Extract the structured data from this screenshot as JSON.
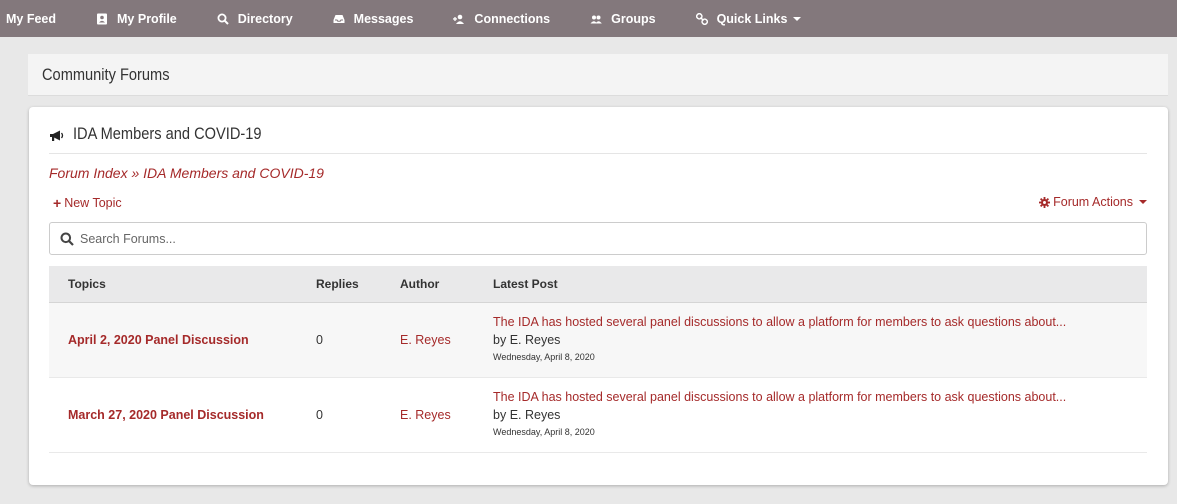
{
  "nav": {
    "items": [
      {
        "label": "My Feed",
        "icon": ""
      },
      {
        "label": "My Profile",
        "icon": "id-card-icon"
      },
      {
        "label": "Directory",
        "icon": "search-icon"
      },
      {
        "label": "Messages",
        "icon": "inbox-icon"
      },
      {
        "label": "Connections",
        "icon": "user-plus-icon"
      },
      {
        "label": "Groups",
        "icon": "users-icon"
      },
      {
        "label": "Quick Links",
        "icon": "link-icon"
      }
    ]
  },
  "page": {
    "title": "Community Forums"
  },
  "forum": {
    "title": "IDA Members and COVID-19",
    "breadcrumb": {
      "index": "Forum Index",
      "separator": "»",
      "current": "IDA Members and COVID-19"
    },
    "new_topic_label": "New Topic",
    "forum_actions_label": "Forum Actions",
    "search_placeholder": "Search Forums..."
  },
  "table": {
    "headers": {
      "topics": "Topics",
      "replies": "Replies",
      "author": "Author",
      "latest": "Latest Post"
    },
    "rows": [
      {
        "topic": "April 2, 2020 Panel Discussion",
        "replies": "0",
        "author": "E. Reyes",
        "excerpt": "The IDA has hosted several panel discussions to allow a platform for members to ask questions about...",
        "by_prefix": "by",
        "by_author": "E. Reyes",
        "date": "Wednesday, April 8, 2020"
      },
      {
        "topic": "March 27, 2020 Panel Discussion",
        "replies": "0",
        "author": "E. Reyes",
        "excerpt": "The IDA has hosted several panel discussions to allow a platform for members to ask questions about...",
        "by_prefix": "by",
        "by_author": "E. Reyes",
        "date": "Wednesday, April 8, 2020"
      }
    ]
  },
  "colors": {
    "nav_bg": "#83787c",
    "accent": "#a52a2a",
    "page_bg": "#e8e8e8"
  }
}
